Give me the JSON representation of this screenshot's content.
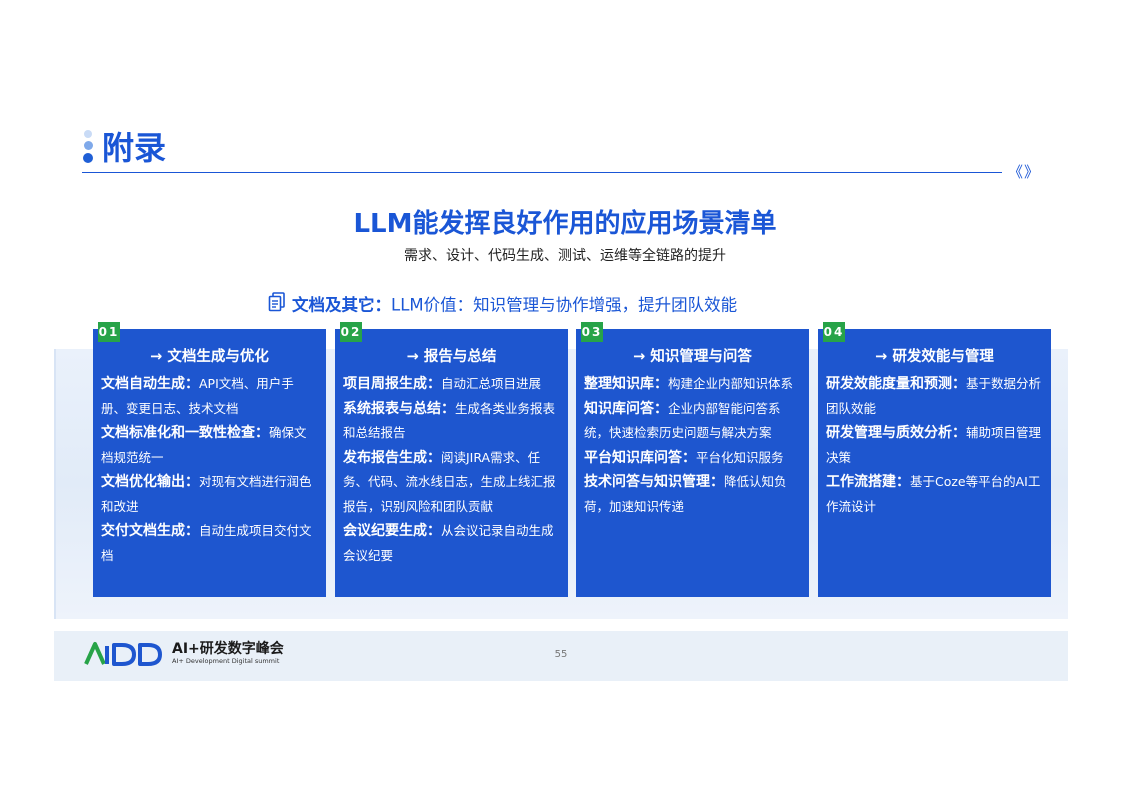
{
  "heading": {
    "title": "附录",
    "nav_glyph": "《》"
  },
  "slide": {
    "title": "LLM能发挥良好作用的应用场景清单",
    "subtitle": "需求、设计、代码生成、测试、运维等全链路的提升"
  },
  "category": {
    "icon": "document-icon",
    "label": "文档及其它：",
    "value": "LLM价值：知识管理与协作增强，提升团队效能"
  },
  "cards": [
    {
      "num": "01",
      "title": "→ 文档生成与优化",
      "items": [
        {
          "key": "文档自动生成：",
          "text": "API文档、用户手册、变更日志、技术文档"
        },
        {
          "key": "文档标准化和一致性检查：",
          "text": "确保文档规范统一"
        },
        {
          "key": "文档优化输出：",
          "text": "对现有文档进行润色和改进"
        },
        {
          "key": "交付文档生成：",
          "text": "自动生成项目交付文档"
        }
      ]
    },
    {
      "num": "02",
      "title": "→ 报告与总结",
      "items": [
        {
          "key": "项目周报生成：",
          "text": "自动汇总项目进展"
        },
        {
          "key": "系统报表与总结：",
          "text": "生成各类业务报表和总结报告"
        },
        {
          "key": "发布报告生成：",
          "text": "阅读JIRA需求、任务、代码、流水线日志，生成上线汇报报告，识别风险和团队贡献"
        },
        {
          "key": "会议纪要生成：",
          "text": "从会议记录自动生成会议纪要"
        }
      ]
    },
    {
      "num": "03",
      "title": "→ 知识管理与问答",
      "items": [
        {
          "key": "整理知识库：",
          "text": "构建企业内部知识体系"
        },
        {
          "key": "知识库问答：",
          "text": "企业内部智能问答系统，快速检索历史问题与解决方案"
        },
        {
          "key": "平台知识库问答：",
          "text": "平台化知识服务"
        },
        {
          "key": "技术问答与知识管理：",
          "text": "降低认知负荷，加速知识传递"
        }
      ]
    },
    {
      "num": "04",
      "title": "→ 研发效能与管理",
      "items": [
        {
          "key": "研发效能度量和预测：",
          "text": "基于数据分析团队效能"
        },
        {
          "key": "研发管理与质效分析：",
          "text": "辅助项目管理决策"
        },
        {
          "key": "工作流搭建：",
          "text": "基于Coze等平台的AI工作流设计"
        }
      ]
    }
  ],
  "footer": {
    "logo_mark": "AiDD",
    "logo_title": "AI+研发数字峰会",
    "logo_subtitle": "AI+ Development Digital summit",
    "page_number": "55"
  },
  "colors": {
    "brand_blue": "#1e56cf",
    "accent_green": "#27a348",
    "heading_blue": "#1a56d6"
  }
}
